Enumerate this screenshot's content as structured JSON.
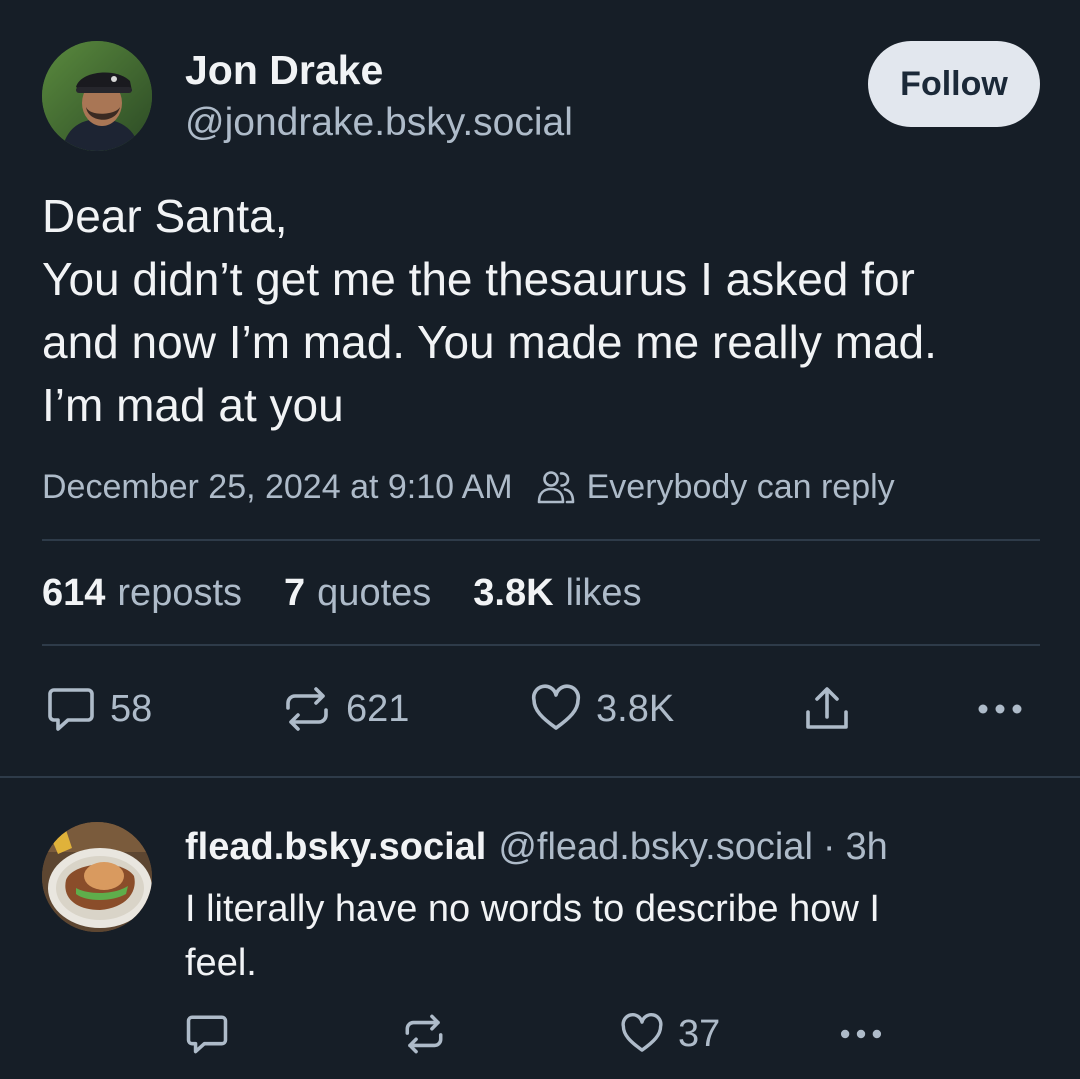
{
  "post": {
    "author": {
      "display_name": "Jon Drake",
      "handle": "@jondrake.bsky.social"
    },
    "follow_label": "Follow",
    "text_lines": [
      "Dear Santa,",
      "You didn’t get me the thesaurus I asked for",
      "and now I’m mad. You made me really mad.",
      "I’m mad at you"
    ],
    "timestamp": "December 25, 2024 at 9:10 AM",
    "reply_setting": "Everybody can reply",
    "reply_setting_icon": "people-icon",
    "stats": {
      "reposts_count": "614",
      "reposts_label": "reposts",
      "quotes_count": "7",
      "quotes_label": "quotes",
      "likes_count": "3.8K",
      "likes_label": "likes"
    },
    "actions": {
      "replies": "58",
      "reposts": "621",
      "likes": "3.8K"
    }
  },
  "reply": {
    "display_name": "flead.bsky.social",
    "handle": "@flead.bsky.social",
    "separator": "·",
    "time_ago": "3h",
    "text_lines": [
      "I literally have no words to describe how I",
      "feel."
    ],
    "actions": {
      "likes": "37"
    }
  },
  "colors": {
    "background": "#161e27",
    "text_primary": "#f1f3f5",
    "text_secondary": "#aebbc9",
    "divider": "#2e3b49",
    "follow_button_bg": "#e2e7ee",
    "follow_button_text": "#1b2938"
  }
}
